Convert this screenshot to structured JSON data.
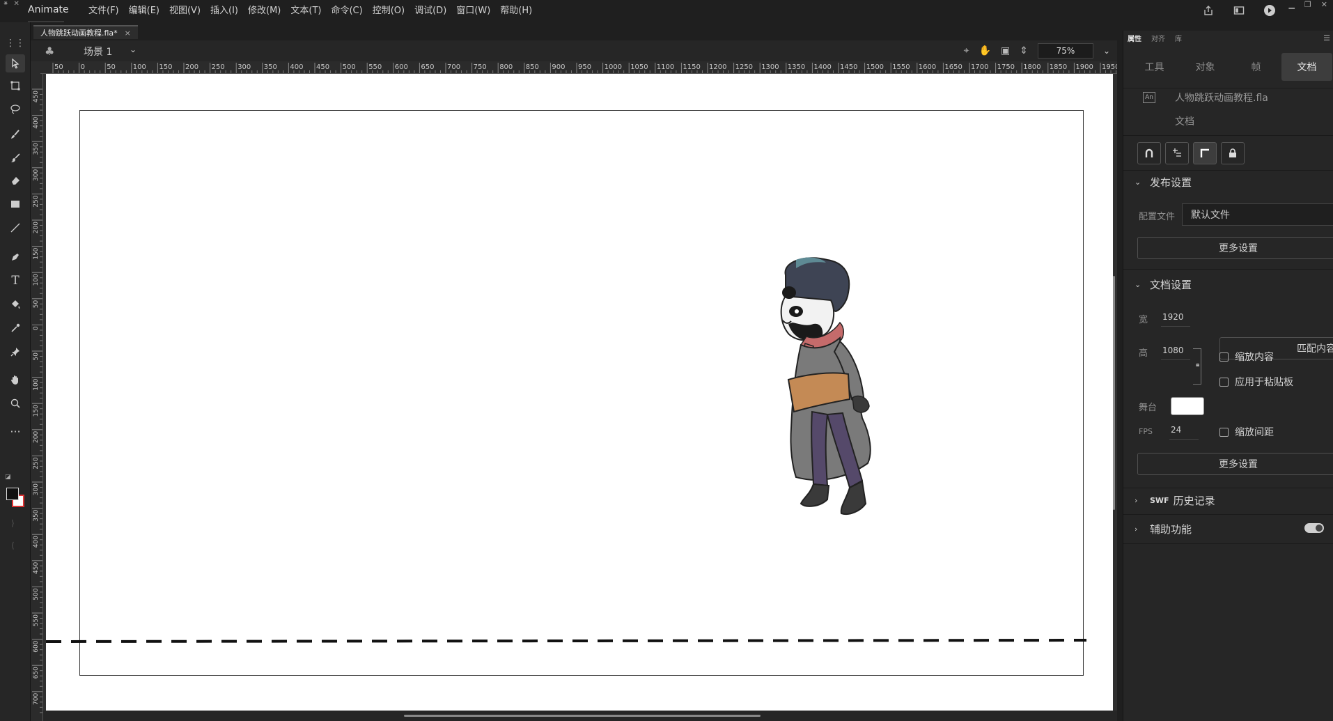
{
  "app": {
    "name": "Animate",
    "menu": [
      "文件(F)",
      "编辑(E)",
      "视图(V)",
      "插入(I)",
      "修改(M)",
      "文本(T)",
      "命令(C)",
      "控制(O)",
      "调试(D)",
      "窗口(W)",
      "帮助(H)"
    ]
  },
  "document_tab": {
    "title": "人物跳跃动画教程.fla*",
    "close": "×"
  },
  "edit_bar": {
    "scene": "场景 1",
    "zoom": "75%"
  },
  "ruler": {
    "top_ticks": [
      "50",
      "0",
      "50",
      "100",
      "150",
      "200",
      "250",
      "300",
      "350",
      "400",
      "450",
      "500",
      "550",
      "600",
      "650",
      "700",
      "750",
      "800",
      "850",
      "900",
      "950",
      "1000",
      "1050",
      "1100",
      "1150",
      "1200",
      "1250",
      "1300",
      "1350",
      "1400",
      "1450",
      "1500",
      "1550",
      "1600",
      "1650",
      "1700",
      "1750",
      "1800",
      "1850",
      "1900",
      "1950"
    ],
    "left_ticks": [
      "450",
      "400",
      "350",
      "300",
      "250",
      "200",
      "150",
      "100",
      "50",
      "0",
      "50",
      "100",
      "150",
      "200",
      "250",
      "300",
      "350",
      "400",
      "450",
      "500",
      "550",
      "600",
      "650",
      "700"
    ]
  },
  "panel": {
    "top_tabs": [
      "属性",
      "对齐",
      "库"
    ],
    "segments": [
      "工具",
      "对象",
      "帧",
      "文档"
    ],
    "doc_icon": "An",
    "file_name": "人物跳跃动画教程.fla",
    "doc_type": "文档",
    "publish": {
      "title": "发布设置",
      "profile_label": "配置文件",
      "profile_value": "默认文件",
      "more": "更多设置"
    },
    "doc_settings": {
      "title": "文档设置",
      "width_label": "宽",
      "width": "1920",
      "height_label": "高",
      "height": "1080",
      "stage_label": "舞台",
      "stage_color": "#ffffff",
      "fps_label": "FPS",
      "fps": "24",
      "match_button": "匹配内容",
      "scale_content": "缩放内容",
      "apply_pasteboard": "应用于粘贴板",
      "scale_spacing": "缩放间距",
      "more": "更多设置"
    },
    "swf_history": {
      "prefix": "SWF",
      "title": "历史记录"
    },
    "accessibility": {
      "title": "辅助功能"
    }
  },
  "colors": {
    "ui_bg": "#1f1f1f",
    "panel_bg": "#262626",
    "stage": "#ffffff",
    "fill_swatch": "#111111",
    "stroke_swatch": "#dd3333"
  },
  "icons": {
    "tools": [
      "selection-icon",
      "free-transform-icon",
      "lasso-icon",
      "fluid-brush-icon",
      "brush-icon",
      "eraser-icon",
      "rectangle-icon",
      "line-icon",
      "pen-icon",
      "text-icon",
      "paint-bucket-icon",
      "eyedropper-icon",
      "pin-icon",
      "hand-icon",
      "zoom-icon",
      "more-tools-icon"
    ]
  }
}
